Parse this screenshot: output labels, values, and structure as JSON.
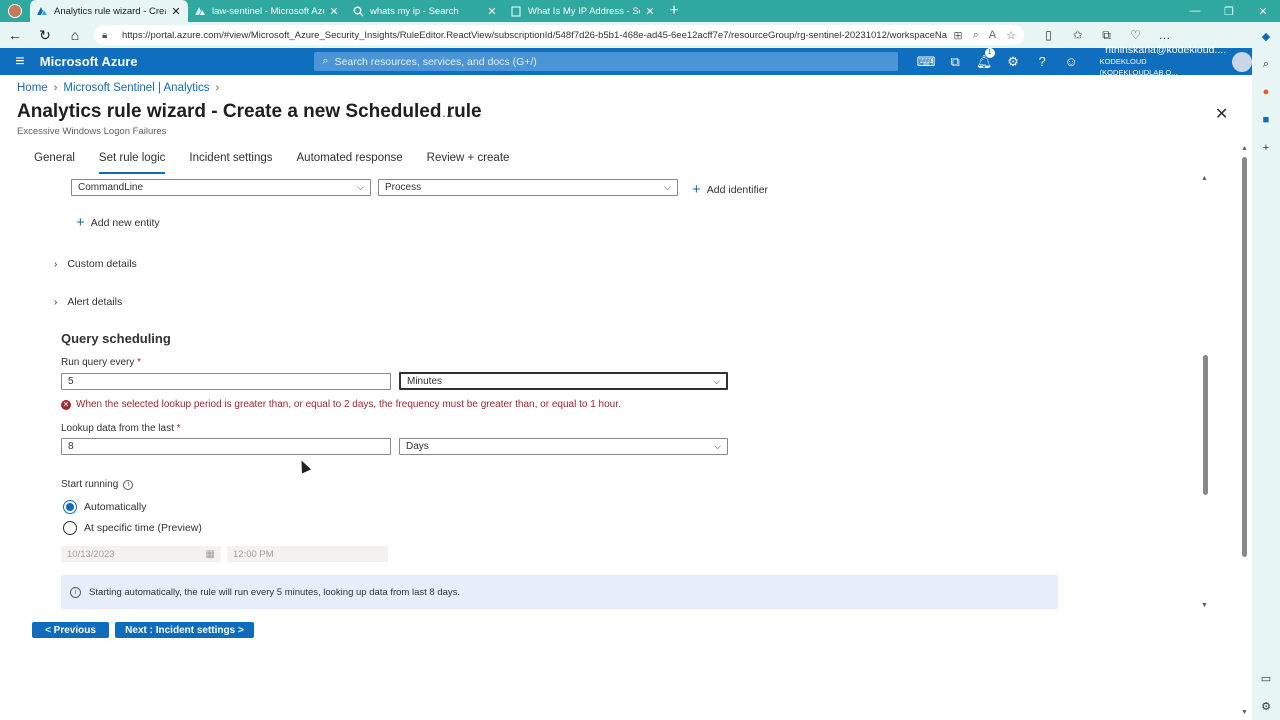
{
  "browser": {
    "tabs": [
      {
        "title": "Analytics rule wizard - Create a n",
        "active": true,
        "icon": "azure-icon"
      },
      {
        "title": "law-sentinel - Microsoft Azure",
        "active": false,
        "icon": "azure-icon"
      },
      {
        "title": "whats my ip - Search",
        "active": false,
        "icon": "search-icon"
      },
      {
        "title": "What Is My IP Address - See Your",
        "active": false,
        "icon": "page-icon"
      }
    ],
    "url": "https://portal.azure.com/#view/Microsoft_Azure_Security_Insights/RuleEditor.ReactView/subscriptionId/548f7d26-b5b1-468e-ad45-6ee12acff7e7/resourceGroup/rg-sentinel-20231012/workspaceName/law-se..."
  },
  "azure": {
    "brand": "Microsoft Azure",
    "search_placeholder": "Search resources, services, and docs (G+/)",
    "notification_count": "1",
    "user_name": "rithinskaria@kodekloud....",
    "user_org": "KODEKLOUD (KODEKLOUDLAB.O..."
  },
  "breadcrumb": [
    {
      "label": "Home"
    },
    {
      "label": "Microsoft Sentinel | Analytics"
    }
  ],
  "page": {
    "title": "Analytics rule wizard - Create a new Scheduled rule",
    "subtitle": "Excessive Windows Logon Failures",
    "more": "..."
  },
  "wizard_tabs": [
    {
      "label": "General",
      "active": false
    },
    {
      "label": "Set rule logic",
      "active": true
    },
    {
      "label": "Incident settings",
      "active": false
    },
    {
      "label": "Automated response",
      "active": false
    },
    {
      "label": "Review + create",
      "active": false
    }
  ],
  "entity_mapping": {
    "identifier_value": "CommandLine",
    "column_value": "Process",
    "add_identifier": "Add identifier",
    "add_entity": "Add new entity"
  },
  "expanders": {
    "custom_details": "Custom details",
    "alert_details": "Alert details"
  },
  "scheduling": {
    "section_title": "Query scheduling",
    "run_every_label": "Run query every",
    "run_every_value": "5",
    "run_every_unit": "Minutes",
    "error": "When the selected lookup period is greater than, or equal to 2 days, the frequency must be greater than, or equal to 1 hour.",
    "lookup_label": "Lookup data from the last",
    "lookup_value": "8",
    "lookup_unit": "Days",
    "start_running_label": "Start running",
    "option_auto": "Automatically",
    "option_specific": "At specific time (Preview)",
    "selected": "Automatically",
    "date": "10/13/2023",
    "time": "12:00 PM",
    "info": "Starting automatically, the rule will run every 5 minutes, looking up data from last 8 days."
  },
  "footer": {
    "previous": "< Previous",
    "next": "Next : Incident settings >"
  },
  "colors": {
    "accent": "#0f6cbd",
    "error": "#a4262c",
    "browser_chrome": "#2fa8a0"
  }
}
